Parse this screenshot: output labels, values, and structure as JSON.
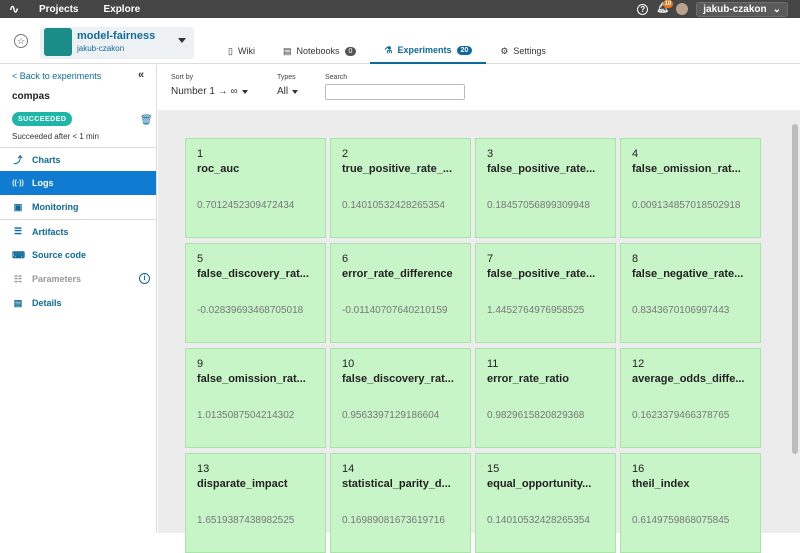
{
  "topbar": {
    "logo": "∿",
    "nav": [
      "Projects",
      "Explore"
    ],
    "notification_count": "10",
    "user": "jakub-czakon"
  },
  "project": {
    "name": "model-fairness",
    "owner": "jakub-czakon"
  },
  "tabs": [
    {
      "label": "Wiki",
      "icon": "book-icon",
      "glyph": "▯"
    },
    {
      "label": "Notebooks",
      "icon": "notebook-icon",
      "glyph": "▤",
      "count": "0"
    },
    {
      "label": "Experiments",
      "icon": "flask-icon",
      "glyph": "⚗",
      "count": "20",
      "active": true
    },
    {
      "label": "Settings",
      "icon": "gear-icon",
      "glyph": "⚙"
    }
  ],
  "sidebar": {
    "back_label": "< Back to experiments",
    "collapse_glyph": "«",
    "experiment_name": "compas",
    "status": "SUCCEEDED",
    "status_color": "#1fb6a8",
    "succeeded_text": "Succeeded after < 1 min",
    "items": [
      {
        "label": "Charts",
        "icon": "chart-line-icon",
        "glyph": "⤴"
      },
      {
        "label": "Logs",
        "icon": "broadcast-icon",
        "glyph": "((·))",
        "active": true
      },
      {
        "label": "Monitoring",
        "icon": "chip-icon",
        "glyph": "▣"
      },
      {
        "label": "Artifacts",
        "icon": "database-icon",
        "glyph": "☰"
      },
      {
        "label": "Source code",
        "icon": "code-icon",
        "glyph": "⌨"
      },
      {
        "label": "Parameters",
        "icon": "sliders-icon",
        "glyph": "☷",
        "disabled": true
      },
      {
        "label": "Details",
        "icon": "document-icon",
        "glyph": "▤"
      }
    ]
  },
  "filters": {
    "sort_label": "Sort by",
    "sort_value": "Number 1 → ∞",
    "types_label": "Types",
    "types_value": "All",
    "search_label": "Search",
    "search_value": ""
  },
  "tiles": [
    {
      "num": "1",
      "name": "roc_auc",
      "value": "0.7012452309472434"
    },
    {
      "num": "2",
      "name": "true_positive_rate_...",
      "value": "0.14010532428265354"
    },
    {
      "num": "3",
      "name": "false_positive_rate...",
      "value": "0.18457056899309948"
    },
    {
      "num": "4",
      "name": "false_omission_rat...",
      "value": "0.009134857018502918"
    },
    {
      "num": "5",
      "name": "false_discovery_rat...",
      "value": "-0.02839693468705018"
    },
    {
      "num": "6",
      "name": "error_rate_difference",
      "value": "-0.01140707640210159"
    },
    {
      "num": "7",
      "name": "false_positive_rate...",
      "value": "1.4452764976958525"
    },
    {
      "num": "8",
      "name": "false_negative_rate...",
      "value": "0.8343670106997443"
    },
    {
      "num": "9",
      "name": "false_omission_rat...",
      "value": "1.0135087504214302"
    },
    {
      "num": "10",
      "name": "false_discovery_rat...",
      "value": "0.9563397129186604"
    },
    {
      "num": "11",
      "name": "error_rate_ratio",
      "value": "0.9829615820829368"
    },
    {
      "num": "12",
      "name": "average_odds_diffe...",
      "value": "0.1623379466378765"
    },
    {
      "num": "13",
      "name": "disparate_impact",
      "value": "1.6519387438982525"
    },
    {
      "num": "14",
      "name": "statistical_parity_d...",
      "value": "0.16989081673619716"
    },
    {
      "num": "15",
      "name": "equal_opportunity...",
      "value": "0.14010532428265354"
    },
    {
      "num": "16",
      "name": "theil_index",
      "value": "0.6149759868075845"
    }
  ]
}
